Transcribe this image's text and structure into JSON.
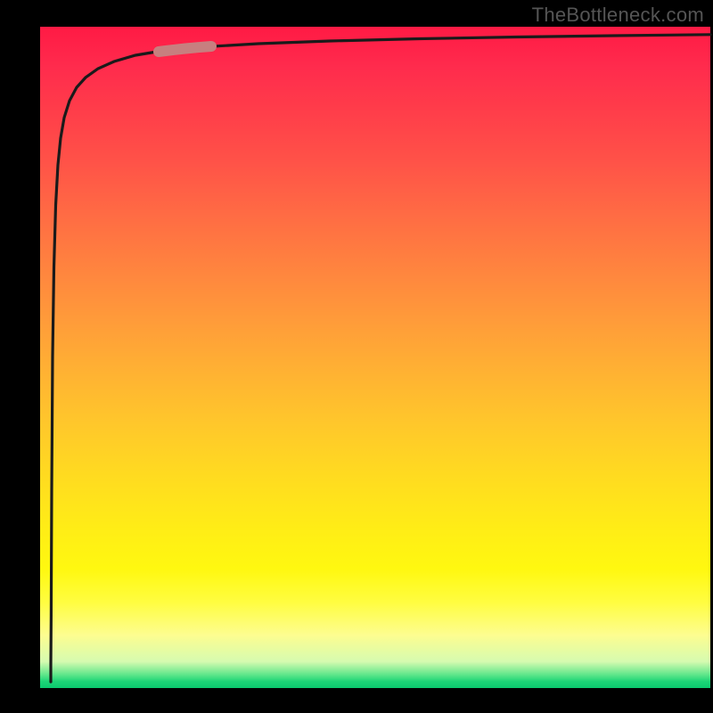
{
  "watermark": "TheBottleneck.com",
  "chart_data": {
    "type": "line",
    "title": "",
    "xlabel": "",
    "ylabel": "",
    "x": [
      0,
      1,
      2,
      3,
      4,
      5,
      6,
      8,
      10,
      14,
      18,
      24,
      30,
      40,
      50,
      60,
      70,
      80,
      90,
      100
    ],
    "values": [
      0,
      5,
      30,
      55,
      70,
      78,
      83,
      88,
      90,
      92,
      93,
      94,
      94.5,
      95,
      95.4,
      95.7,
      96,
      96.2,
      96.4,
      96.6
    ],
    "xlim": [
      0,
      100
    ],
    "ylim": [
      0,
      100
    ],
    "marker": {
      "x_range": [
        20,
        27
      ],
      "y_range": [
        91,
        94
      ],
      "color": "#c97d7d"
    },
    "background_gradient": {
      "top": "#ff1a44",
      "middle": "#ffd820",
      "bottom": "#0bc96e"
    }
  }
}
